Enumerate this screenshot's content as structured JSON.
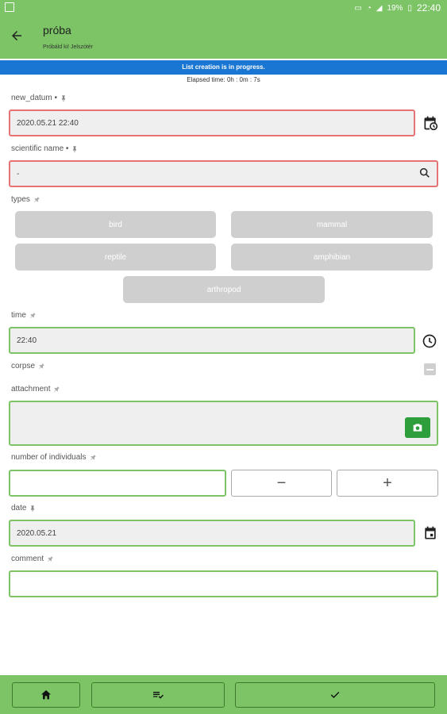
{
  "status_bar": {
    "battery": "19%",
    "clock": "22:40"
  },
  "app_bar": {
    "title": "próba",
    "subtitle": "Próbáld ki! Jelszótér"
  },
  "progress": {
    "banner": "List creation is in progress.",
    "elapsed": "Elapsed time: 0h : 0m : 7s"
  },
  "fields": {
    "new_datum": {
      "label": "new_datum •",
      "value": "2020.05.21 22:40"
    },
    "scientific_name": {
      "label": "scientific name •",
      "value": "-"
    },
    "types": {
      "label": "types",
      "options": [
        {
          "label": "bird",
          "selected": true
        },
        {
          "label": "mammal",
          "selected": false
        },
        {
          "label": "reptile",
          "selected": false
        },
        {
          "label": "amphibian",
          "selected": false
        },
        {
          "label": "arthropod",
          "selected": false
        }
      ]
    },
    "time": {
      "label": "time",
      "value": "22:40"
    },
    "corpse": {
      "label": "corpse"
    },
    "attachment": {
      "label": "attachment"
    },
    "number_of_individuals": {
      "label": "number of individuals",
      "value": "",
      "minus": "−",
      "plus": "+"
    },
    "date": {
      "label": "date",
      "value": "2020.05.21"
    },
    "comment": {
      "label": "comment",
      "value": ""
    }
  },
  "colors": {
    "accent": "#7cc466",
    "banner": "#1976d2",
    "error_border": "#e57373",
    "chip_inactive": "#cfcfcf",
    "camera_button": "#2e9e3d"
  },
  "icons": [
    "back-arrow-icon",
    "calendar-clock-icon",
    "search-icon",
    "pin-icon",
    "clock-icon",
    "camera-icon",
    "calendar-icon",
    "home-icon",
    "checklist-icon",
    "checkmark-icon"
  ]
}
